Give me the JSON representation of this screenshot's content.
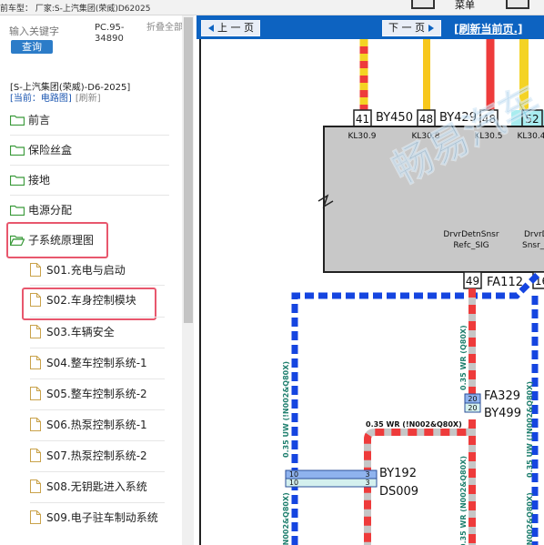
{
  "topbar": {
    "vehicle_label": "前车型： 厂家:S-上汽集团(荣威)D62025",
    "right_label": "菜单"
  },
  "sidebar": {
    "search_placeholder": "输入关键字",
    "search_button": "查询",
    "part_code": "PC.95-34890",
    "collapse_all": "折叠全部",
    "vehicle_path": "[S-上汽集团(荣威)-D6-2025]",
    "current_label": "[当前：电路图]",
    "refresh_label": "[刷新]",
    "tree": [
      {
        "label": "前言",
        "type": "folder"
      },
      {
        "label": "保险丝盒",
        "type": "folder"
      },
      {
        "label": "接地",
        "type": "folder"
      },
      {
        "label": "电源分配",
        "type": "folder"
      },
      {
        "label": "子系统原理图",
        "type": "folder-open",
        "selected": true
      },
      {
        "label": "S01.充电与启动",
        "type": "doc"
      },
      {
        "label": "S02.车身控制模块",
        "type": "doc",
        "selected": true
      },
      {
        "label": "S03.车辆安全",
        "type": "doc"
      },
      {
        "label": "S04.整车控制系统-1",
        "type": "doc"
      },
      {
        "label": "S05.整车控制系统-2",
        "type": "doc"
      },
      {
        "label": "S06.热泵控制系统-1",
        "type": "doc"
      },
      {
        "label": "S07.热泵控制系统-2",
        "type": "doc"
      },
      {
        "label": "S08.无钥匙进入系统",
        "type": "doc"
      },
      {
        "label": "S09.电子驻车制动系统",
        "type": "doc"
      }
    ],
    "highlight_color": "#e8576d"
  },
  "viewer": {
    "prev_page": "上 一 页",
    "next_page": "下 一 页",
    "refresh_page": "[刷新当前页.]",
    "accent": "#0d63c1"
  },
  "diagram": {
    "pins_top": [
      "41",
      "48",
      "48",
      "52"
    ],
    "connectors_top": [
      "BY450",
      "BY429"
    ],
    "pin_signals": [
      "KL30.9",
      "KL30.8",
      "KL30.5",
      "KL30.4"
    ],
    "module_signal_1": "DrvrDetnSnsr",
    "module_signal_1b": "Refc_SIG",
    "module_signal_2": "DrvrD",
    "module_signal_2b": "Snsr_",
    "pin_bottom_1": "49",
    "pin_bottom_2": "16",
    "connector_bottom": "FA112",
    "wire_wr": "0.35 WR (Q80X)",
    "splice_pin_top": "20",
    "splice_pin_bottom": "20",
    "splice_connector_1": "FA329",
    "splice_connector_2": "BY499",
    "wire_horizontal": "0.35 WR (!N002&Q80X)",
    "wire_left_1": "0.35 UW (!N002&Q80X)",
    "wire_right_1": "0.35 UW (!N002&Q80X)",
    "conn2_pin_left": "10",
    "conn2_pin_right": "3",
    "conn2_connector_1": "BY192",
    "conn2_connector_2": "DS009",
    "wire_left_2": "(N002&Q80X)",
    "wire_mid_2": "0.35 WR (N002&Q80X)",
    "wire_right_2": "(N002&Q80X)",
    "watermark": "畅易汽车",
    "wire_colors": {
      "blue": "#1545e0",
      "red": "#ee3b3b",
      "yellow": "#f4d324",
      "gray": "#c6c6c6",
      "teal": "#1f7f6e"
    }
  }
}
